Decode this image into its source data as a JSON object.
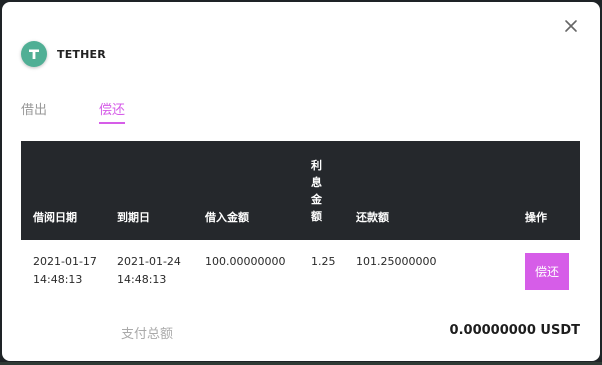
{
  "coin": {
    "name": "TETHER",
    "icon": "tether-icon",
    "brand_color": "#50af95"
  },
  "tabs": [
    {
      "label": "借出",
      "active": false
    },
    {
      "label": "偿还",
      "active": true
    }
  ],
  "accent_color": "#d65de8",
  "table": {
    "headers": {
      "borrow_date": "借阅日期",
      "due_date": "到期日",
      "borrow_amount": "借入金额",
      "interest_amount": "利息金额",
      "repay_amount": "还款额",
      "action": "操作"
    },
    "rows": [
      {
        "borrow_date": "2021-01-17",
        "borrow_time": "14:48:13",
        "due_date": "2021-01-24",
        "due_time": "14:48:13",
        "borrow_amount": "100.00000000",
        "interest_amount": "1.25",
        "repay_amount": "101.25000000",
        "action_label": "偿还"
      }
    ]
  },
  "total": {
    "label": "支付总额",
    "value": "0.00000000 USDT"
  }
}
